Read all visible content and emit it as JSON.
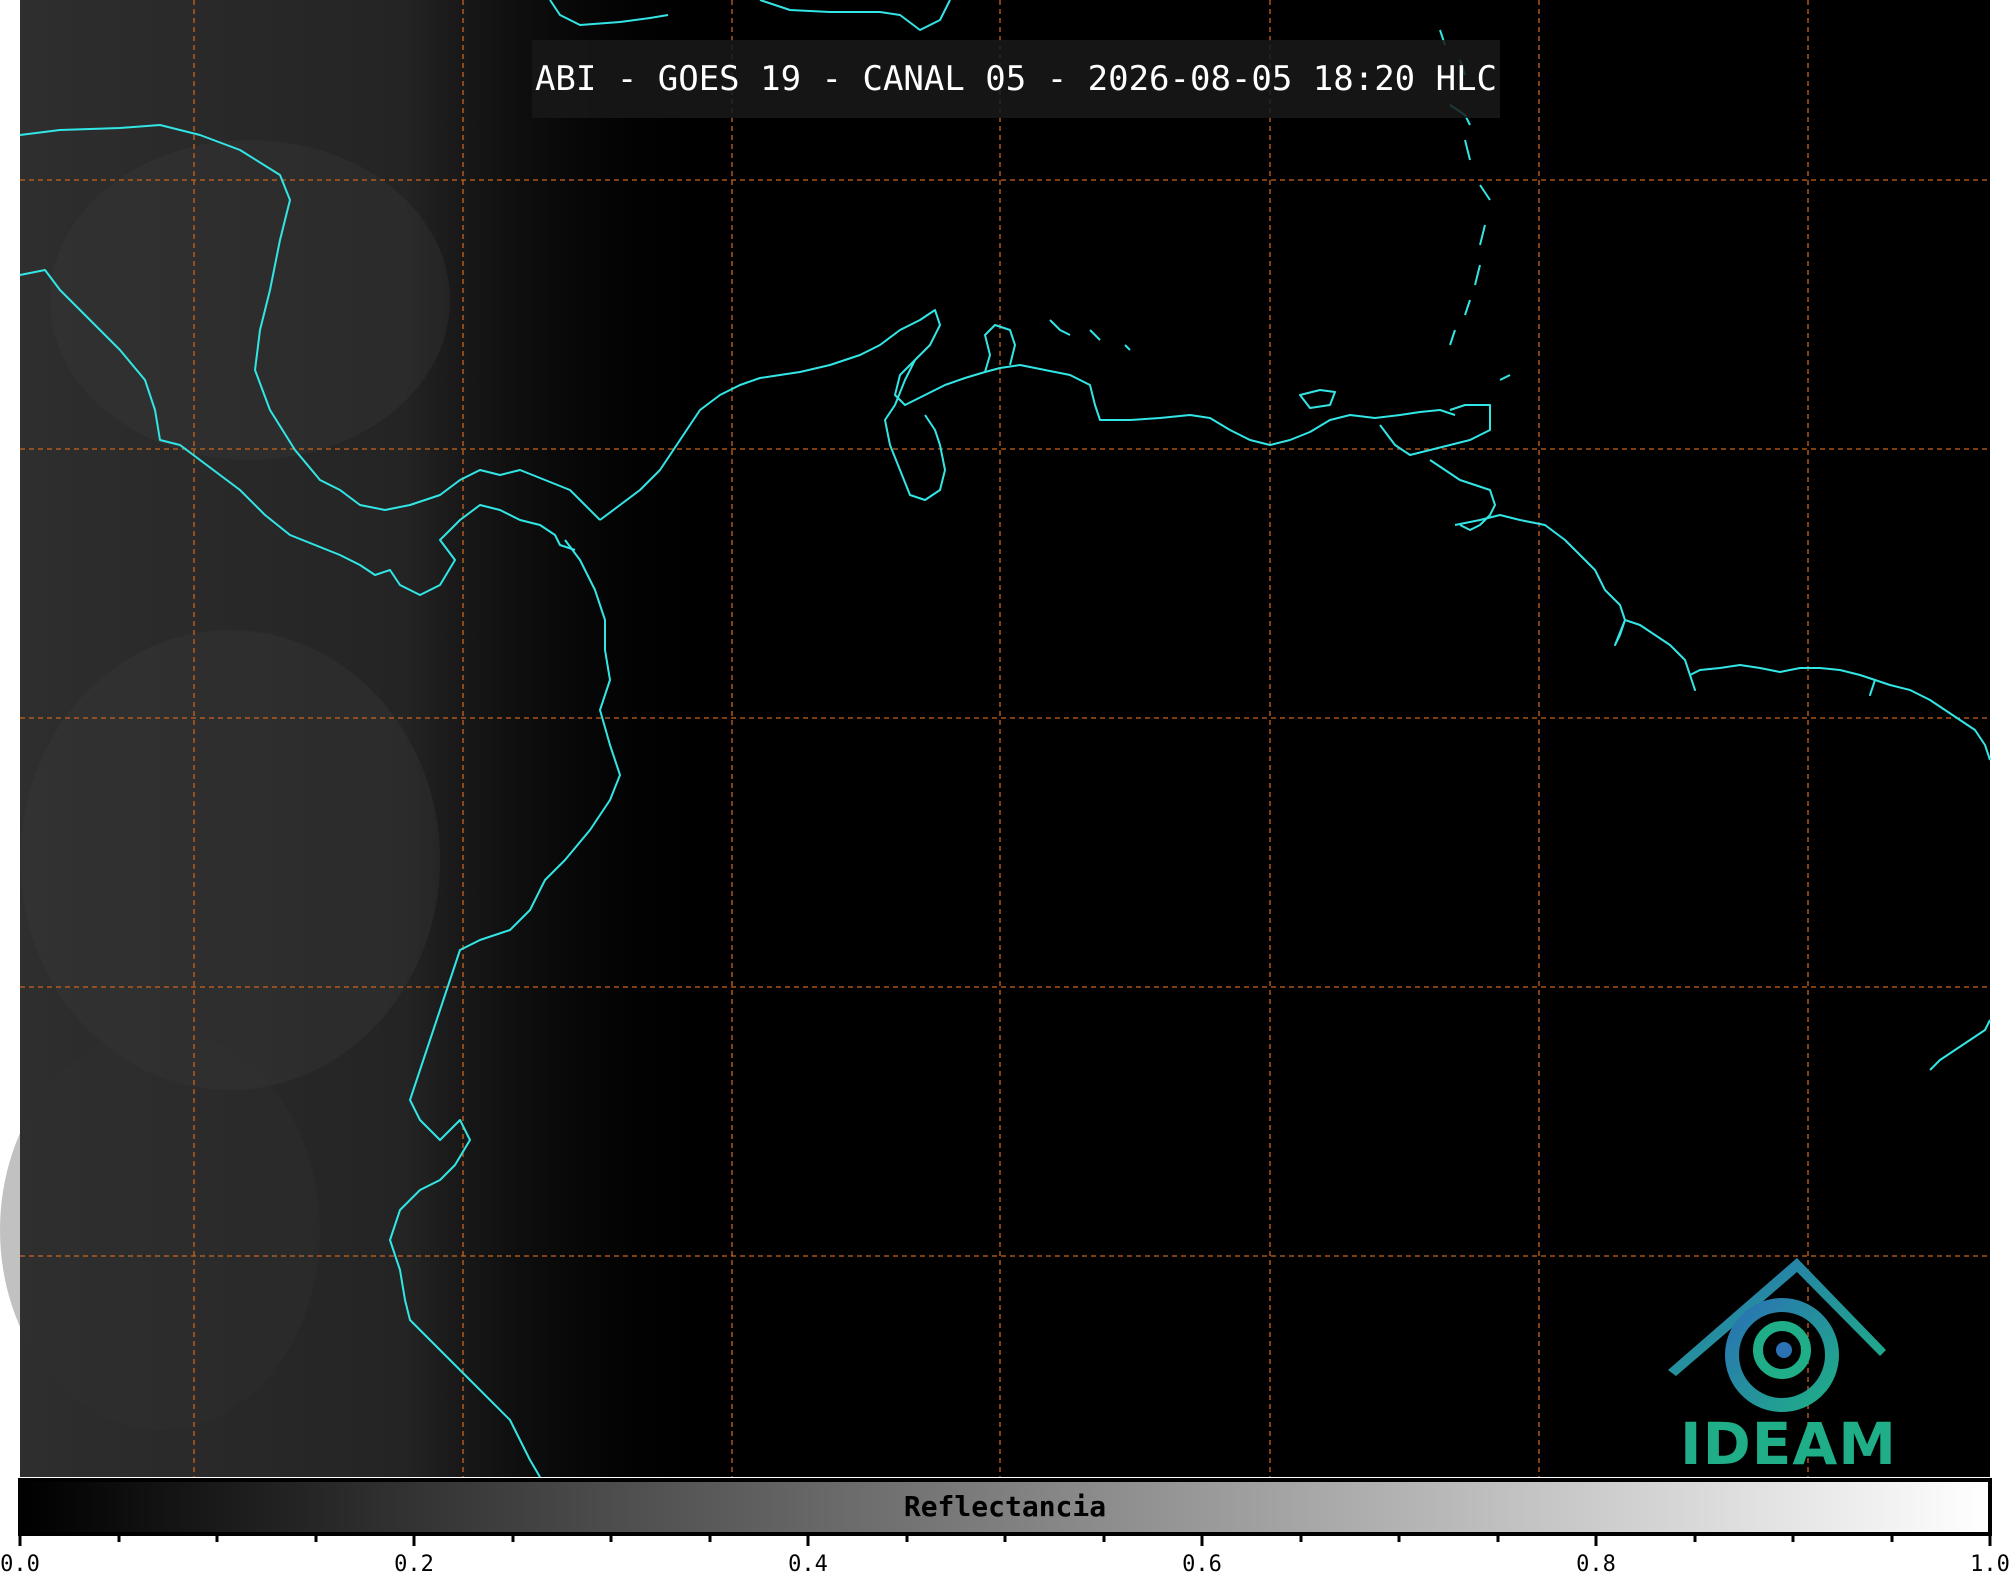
{
  "title": "ABI - GOES 19 - CANAL 05 - 2026-08-05 18:20 HLC",
  "colorbar": {
    "label": "Reflectancia",
    "ticks": [
      "0.0",
      "0.2",
      "0.4",
      "0.6",
      "0.8",
      "1.0"
    ]
  },
  "logo": {
    "text": "IDEAM"
  },
  "colors": {
    "coastline": "#33e6e6",
    "graticule": "#c8641e",
    "background": "#000000",
    "logo_green": "#1fae87",
    "logo_blue": "#2a72b4"
  }
}
